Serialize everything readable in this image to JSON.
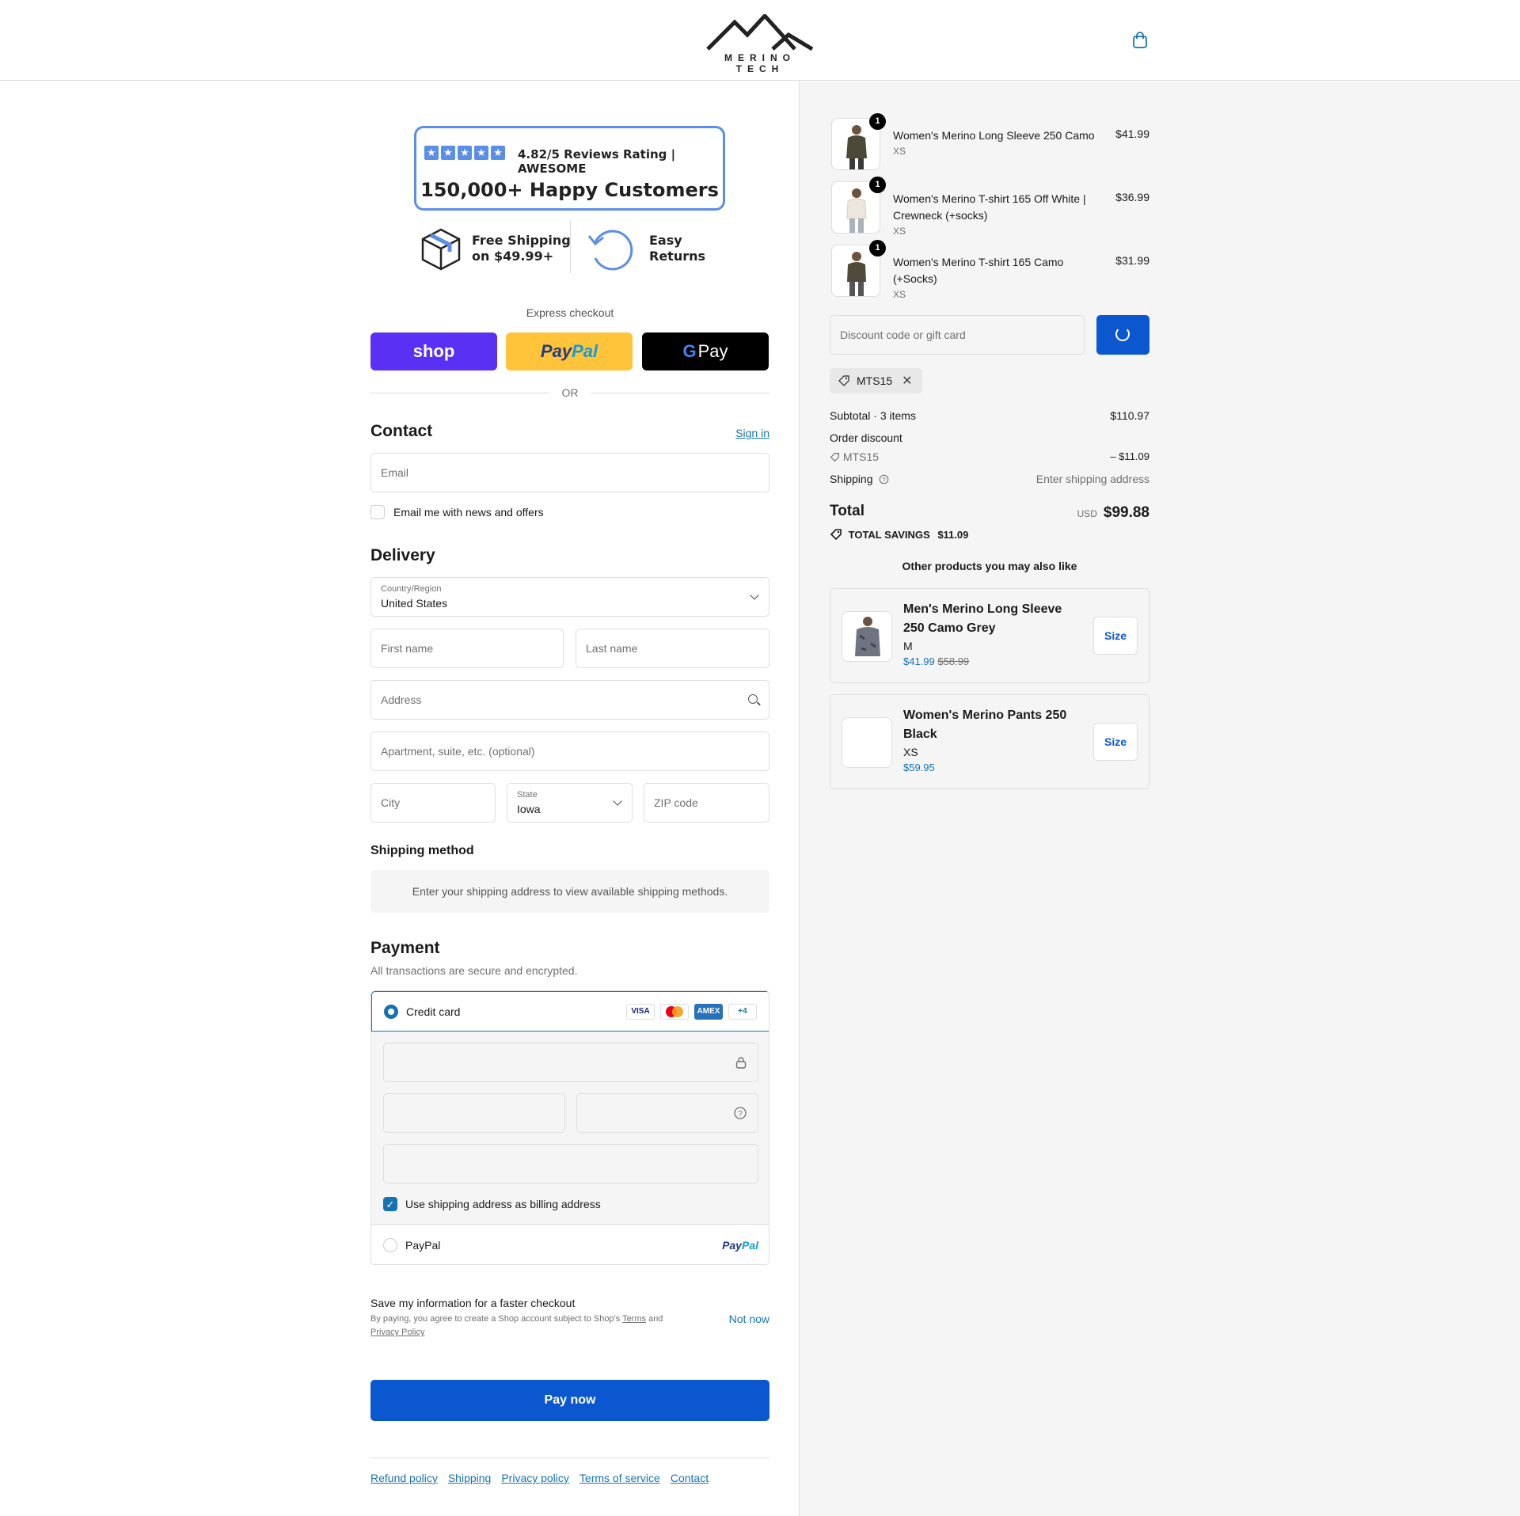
{
  "header": {
    "brand": "MERINO TECH",
    "cart_icon": "shopping-bag-icon"
  },
  "trust": {
    "rating": "4.82/5 Reviews Rating | AWESOME",
    "customers": "150,000+ Happy Customers",
    "shipping_line1": "Free Shipping",
    "shipping_line2": "on $49.99+",
    "returns_line1": "Easy",
    "returns_line2": "Returns"
  },
  "express": {
    "label": "Express checkout",
    "shop": "shop",
    "paypal_a": "Pay",
    "paypal_b": "Pal",
    "gpay": "Pay",
    "or": "OR"
  },
  "contact": {
    "title": "Contact",
    "sign_in": "Sign in",
    "email_placeholder": "Email",
    "newsletter": "Email me with news and offers"
  },
  "delivery": {
    "title": "Delivery",
    "country_label": "Country/Region",
    "country_value": "United States",
    "first_name": "First name",
    "last_name": "Last name",
    "address": "Address",
    "apartment": "Apartment, suite, etc. (optional)",
    "city": "City",
    "state_label": "State",
    "state_value": "Iowa",
    "zip": "ZIP code"
  },
  "shipping_method": {
    "title": "Shipping method",
    "message": "Enter your shipping address to view available shipping methods."
  },
  "payment": {
    "title": "Payment",
    "subtitle": "All transactions are secure and encrypted.",
    "credit_card": "Credit card",
    "cards": [
      "VISA",
      "MC",
      "AMEX",
      "+4"
    ],
    "billing_same": "Use shipping address as billing address",
    "paypal": "PayPal",
    "paypal_logo_a": "Pay",
    "paypal_logo_b": "Pal"
  },
  "save_info": {
    "title": "Save my information for a faster checkout",
    "text_a": "By paying, you agree to create a Shop account subject to Shop's ",
    "terms": "Terms",
    "and": " and",
    "privacy": "Privacy Policy",
    "not_now": "Not now"
  },
  "pay_now": "Pay now",
  "footer": [
    "Refund policy",
    "Shipping",
    "Privacy policy",
    "Terms of service",
    "Contact"
  ],
  "cart": {
    "items": [
      {
        "qty": "1",
        "name": "Women's Merino Long Sleeve 250 Camo",
        "variant": "XS",
        "price": "$41.99",
        "color": "#4b4a38"
      },
      {
        "qty": "1",
        "name": "Women's Merino T-shirt 165 Off White | Crewneck (+socks)",
        "variant": "XS",
        "price": "$36.99",
        "color": "#ece6dc"
      },
      {
        "qty": "1",
        "name": "Women's Merino T-shirt 165 Camo (+Socks)",
        "variant": "XS",
        "price": "$31.99",
        "color": "#4f4a3a"
      }
    ],
    "discount_placeholder": "Discount code or gift card",
    "applied_code": "MTS15",
    "subtotal_label": "Subtotal · 3 items",
    "subtotal": "$110.97",
    "order_discount": "Order discount",
    "discount_code": "MTS15",
    "discount_value": "– $11.09",
    "shipping_label": "Shipping",
    "shipping_value": "Enter shipping address",
    "total_label": "Total",
    "currency": "USD",
    "total": "$99.88",
    "savings_label": "TOTAL SAVINGS",
    "savings": "$11.09",
    "suggest_title": "Other products you may also like",
    "suggestions": [
      {
        "name": "Men's Merino Long Sleeve 250 Camo Grey",
        "variant": "M",
        "price": "$41.99",
        "compare": "$58.99",
        "size": "Size"
      },
      {
        "name": "Women's Merino Pants 250 Black",
        "variant": "XS",
        "price": "$59.95",
        "compare": "",
        "size": "Size"
      }
    ]
  },
  "colors": {
    "accent": "#1773b0",
    "primary_button": "#0b57d0",
    "shop_pay": "#5a31f4",
    "paypal_yellow": "#ffc439"
  }
}
